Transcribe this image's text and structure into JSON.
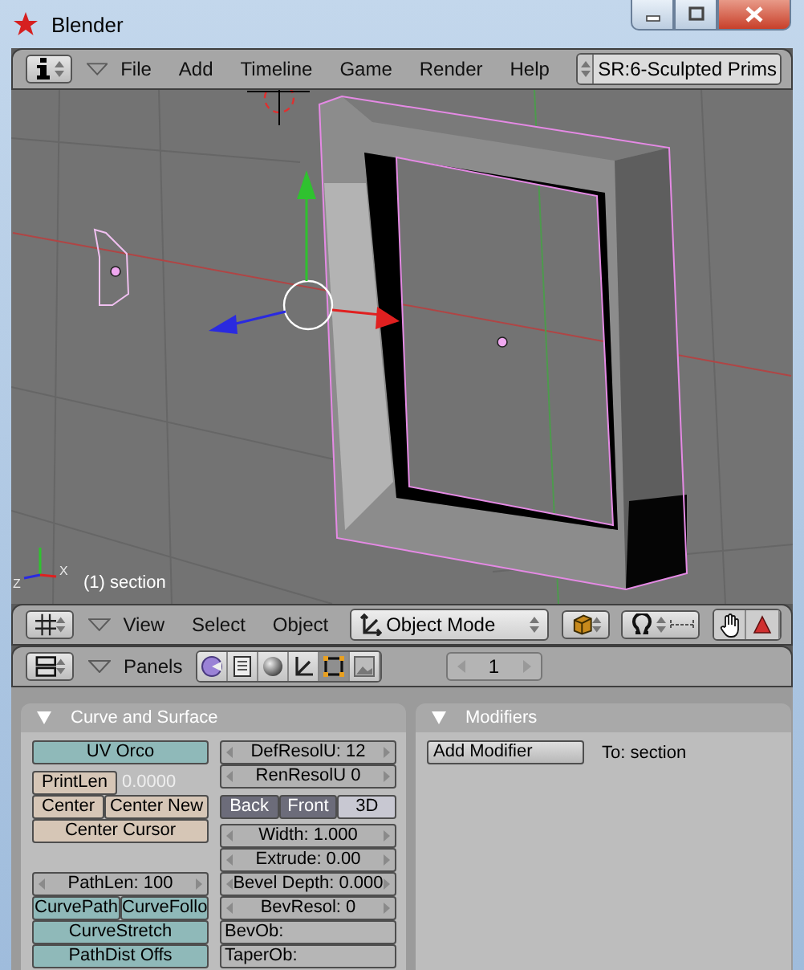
{
  "window": {
    "title": "Blender"
  },
  "info_header": {
    "menus": [
      "File",
      "Add",
      "Timeline",
      "Game",
      "Render",
      "Help"
    ],
    "scene": "SR:6-Sculpted Prims"
  },
  "viewport": {
    "object_label": "(1) section",
    "axis_labels": [
      "Z",
      "X"
    ]
  },
  "view_header": {
    "menus": [
      "View",
      "Select",
      "Object"
    ],
    "mode": "Object Mode"
  },
  "buttons_header": {
    "label": "Panels",
    "frame": "1",
    "tabs": [
      {
        "kind": "logic",
        "selected": false
      },
      {
        "kind": "script",
        "selected": false
      },
      {
        "kind": "shading",
        "selected": false
      },
      {
        "kind": "object",
        "selected": false
      },
      {
        "kind": "editing",
        "selected": true
      },
      {
        "kind": "scene",
        "selected": false
      }
    ]
  },
  "panels": [
    {
      "kind": "curve",
      "title": "Curve and Surface",
      "columns": [
        [
          [
            [
              {
                "kind": "toggle",
                "label": "UV Orco",
                "on": false
              }
            ]
          ],
          [
            [
              {
                "kind": "action",
                "label": "PrintLen"
              },
              {
                "kind": "readout",
                "label": "0.0000"
              }
            ],
            [
              {
                "kind": "action",
                "label": "Center"
              },
              {
                "kind": "action",
                "label": "Center New"
              }
            ],
            [
              {
                "kind": "action",
                "label": "Center Cursor"
              }
            ]
          ],
          [
            [
              {
                "kind": "number",
                "label": "PathLen: 100"
              }
            ],
            [
              {
                "kind": "toggle",
                "label": "CurvePath",
                "on": false
              },
              {
                "kind": "toggle",
                "label": "CurveFollo",
                "on": false
              }
            ],
            [
              {
                "kind": "toggle",
                "label": "CurveStretch",
                "on": false
              }
            ],
            [
              {
                "kind": "toggle",
                "label": "PathDist Offs",
                "on": false
              }
            ]
          ]
        ],
        [
          [
            [
              {
                "kind": "number",
                "label": "DefResolU: 12"
              }
            ],
            [
              {
                "kind": "number",
                "label": "RenResolU 0"
              }
            ]
          ],
          [
            [
              {
                "kind": "option",
                "label": "Back",
                "on": true
              },
              {
                "kind": "option",
                "label": "Front",
                "on": true
              },
              {
                "kind": "option",
                "label": "3D",
                "on": false
              }
            ]
          ],
          [
            [
              {
                "kind": "number",
                "label": "Width: 1.000"
              }
            ],
            [
              {
                "kind": "number",
                "label": "Extrude: 0.00"
              }
            ],
            [
              {
                "kind": "number",
                "label": "Bevel Depth: 0.000"
              }
            ],
            [
              {
                "kind": "number",
                "label": "BevResol: 0"
              }
            ],
            [
              {
                "kind": "text",
                "label": "BevOb:"
              }
            ],
            [
              {
                "kind": "text",
                "label": "TaperOb:"
              }
            ]
          ]
        ]
      ]
    },
    {
      "kind": "modifiers",
      "title": "Modifiers",
      "button": "Add Modifier",
      "target": "To: section"
    }
  ]
}
